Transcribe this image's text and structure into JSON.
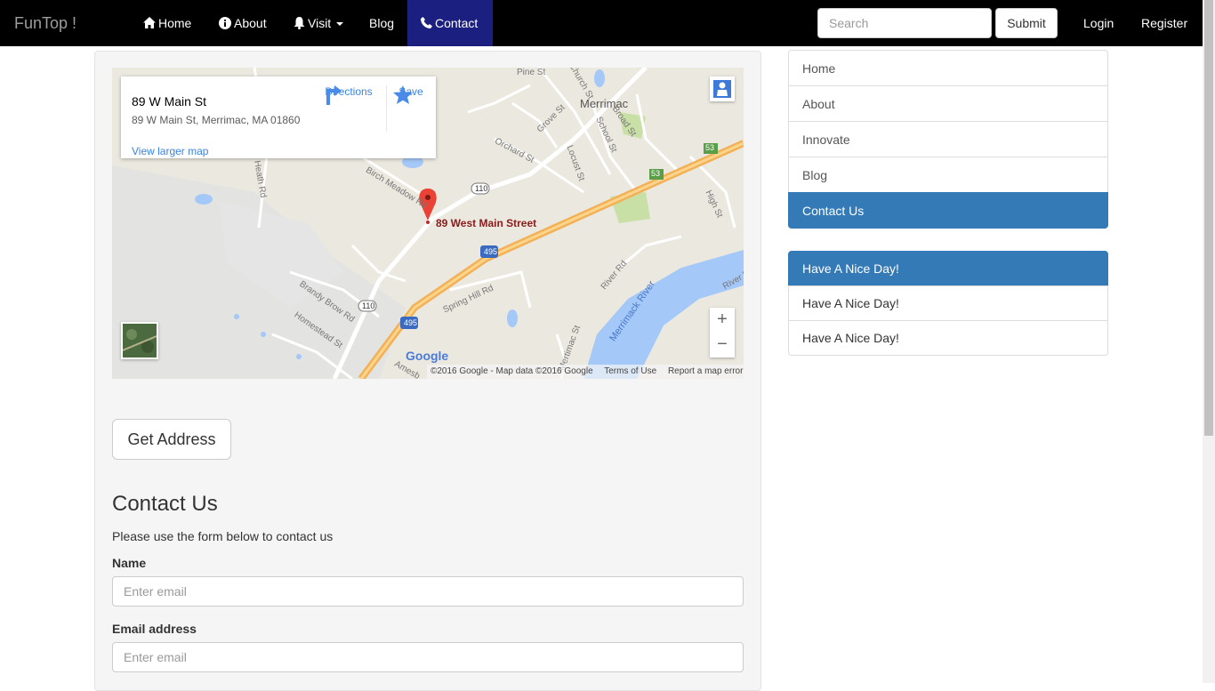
{
  "navbar": {
    "brand": "FunTop !",
    "items": [
      {
        "label": "Home",
        "icon": "home-icon"
      },
      {
        "label": "About",
        "icon": "info-icon"
      },
      {
        "label": "Visit",
        "icon": "bell-icon"
      },
      {
        "label": "Blog"
      },
      {
        "label": "Contact",
        "icon": "phone-icon"
      }
    ],
    "search_placeholder": "Search",
    "submit_label": "Submit",
    "login": "Login",
    "register": "Register",
    "active_bg": "#1a1f80"
  },
  "map": {
    "place_name": "89 W Main St",
    "place_address": "89 W Main St, Merrimac, MA 01860",
    "directions": "Directions",
    "save": "Save",
    "view_larger": "View larger map",
    "marker_label": "89 West Main Street",
    "zoom_in": "+",
    "zoom_out": "−",
    "logo": "Google",
    "copyright": "©2016 Google - Map data ©2016 Google",
    "terms": "Terms of Use",
    "report": "Report a map error",
    "labels": {
      "merrimac": "Merrimac",
      "pine": "Pine St",
      "church": "Church St",
      "grove": "Grove St",
      "school": "School St",
      "broad": "Broad St",
      "orchard": "Orchard St",
      "locust": "Locust St",
      "high": "High St",
      "heath": "Heath Rd",
      "birch": "Birch Meadow Rd",
      "brandy": "Brandy Brow Rd",
      "homestead": "Homestead St",
      "spring": "Spring Hill Rd",
      "river_rd": "River Rd",
      "river_rd2": "River Rd",
      "merrimack_river": "Merrimack River",
      "mertimac": "Mertimac St",
      "amesbury": "Amesb",
      "r110a": "110",
      "r110b": "110",
      "i495a": "495",
      "i495b": "495",
      "r53a": "53",
      "r53b": "53"
    }
  },
  "get_address_label": "Get Address",
  "contact": {
    "title": "Contact Us",
    "description": "Please use the form below to contact us",
    "name_label": "Name",
    "name_placeholder": "Enter email",
    "email_label": "Email address",
    "email_placeholder": "Enter email"
  },
  "sidebar": {
    "nav": [
      "Home",
      "About",
      "Innovate",
      "Blog",
      "Contact Us"
    ],
    "extra": [
      "Have A Nice Day!",
      "Have A Nice Day!",
      "Have A Nice Day!"
    ],
    "accent": "#337ab7"
  }
}
